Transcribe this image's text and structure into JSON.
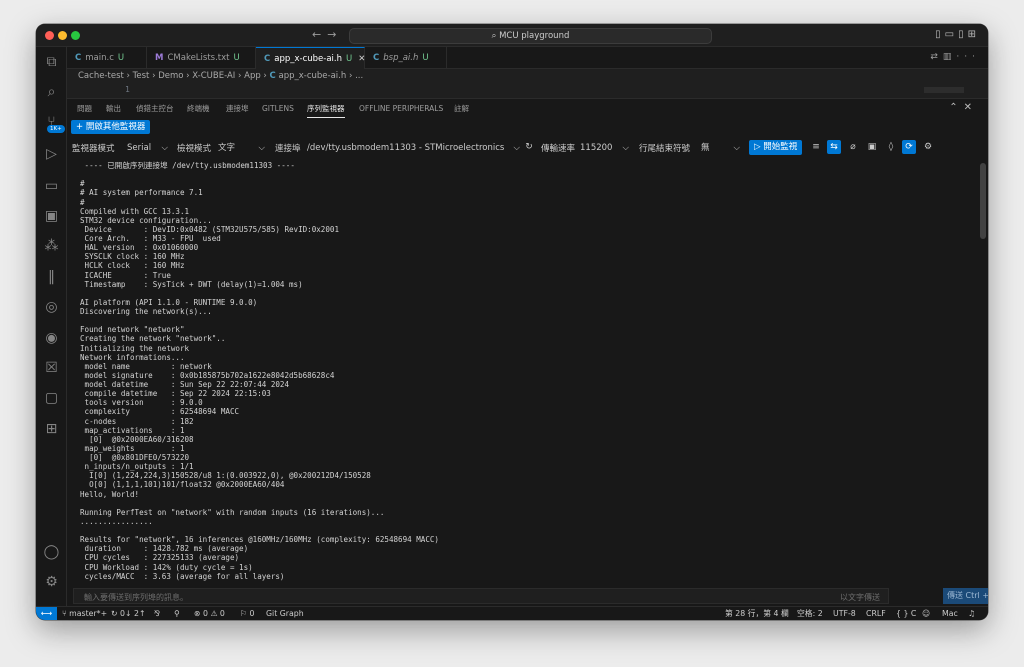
{
  "window": {
    "title": "MCU playground",
    "search_icon": "search-icon"
  },
  "tabs": [
    {
      "lang": "C",
      "label": "main.c",
      "status": "U",
      "active": false
    },
    {
      "lang": "M",
      "label": "CMakeLists.txt",
      "status": "U",
      "active": false
    },
    {
      "lang": "C",
      "label": "app_x-cube-ai.h",
      "status": "U",
      "active": true
    },
    {
      "lang": "C",
      "label": "bsp_ai.h",
      "status": "U",
      "active": false
    }
  ],
  "breadcrumb": {
    "parts": [
      "Cache-test",
      "Test",
      "Demo",
      "X-CUBE-AI",
      "App",
      "C",
      "app_x-cube-ai.h",
      "..."
    ]
  },
  "editor": {
    "line_number": "1"
  },
  "panel": {
    "tabs": [
      "問題",
      "輸出",
      "偵錯主控台",
      "終端機",
      "連接埠",
      "GITLENS",
      "序列監視器",
      "OFFLINE PERIPHERALS",
      "註解"
    ],
    "active_tab": "序列監視器",
    "open_other_monitor": "開啟其他監視器"
  },
  "monitor": {
    "mode_label": "監視器模式",
    "mode_value": "Serial",
    "view_label": "檢視模式",
    "view_value": "文字",
    "port_label": "連接埠",
    "port_value": "/dev/tty.usbmodem11303 - STMicroelectronics",
    "baud_label": "傳輸速率",
    "baud_value": "115200",
    "eol_label": "行尾結束符號",
    "eol_value": "無",
    "start_button": "開始監視"
  },
  "output_lines": [
    " ---- 已開啟序列連接埠 /dev/tty.usbmodem11303 ----",
    "",
    "#",
    "# AI system performance 7.1",
    "#",
    "Compiled with GCC 13.3.1",
    "STM32 device configuration...",
    " Device       : DevID:0x0482 (STM32U575/585) RevID:0x2001",
    " Core Arch.   : M33 - FPU  used",
    " HAL version  : 0x01060000",
    " SYSCLK clock : 160 MHz",
    " HCLK clock   : 160 MHz",
    " ICACHE       : True",
    " Timestamp    : SysTick + DWT (delay(1)=1.004 ms)",
    "",
    "AI platform (API 1.1.0 - RUNTIME 9.0.0)",
    "Discovering the network(s)...",
    "",
    "Found network \"network\"",
    "Creating the network \"network\"..",
    "Initializing the network",
    "Network informations...",
    " model name         : network",
    " model signature    : 0x0b185875b702a1622e8042d5b68628c4",
    " model datetime     : Sun Sep 22 22:07:44 2024",
    " compile datetime   : Sep 22 2024 22:15:03",
    " tools version      : 9.0.0",
    " complexity         : 62548694 MACC",
    " c-nodes            : 182",
    " map_activations    : 1",
    "  [0]  @0x2000EA60/316208",
    " map_weights        : 1",
    "  [0]  @0x801DFE0/573220",
    " n_inputs/n_outputs : 1/1",
    "  I[0] (1,224,224,3)150528/u8 1:(0.003922,0), @0x200212D4/150528",
    "  O[0] (1,1,1,101)101/float32 @0x2000EA60/404",
    "Hello, World!",
    "",
    "Running PerfTest on \"network\" with random inputs (16 iterations)...",
    "................",
    "",
    "Results for \"network\", 16 inferences @160MHz/160MHz (complexity: 62548694 MACC)",
    " duration     : 1428.782 ms (average)",
    " CPU cycles   : 227325133 (average)",
    " CPU Workload : 142% (duty cycle = 1s)",
    " cycles/MACC  : 3.63 (average for all layers)"
  ],
  "input_bar": {
    "placeholder": "輸入要傳送到序列埠的訊息。",
    "hint": "以文字傳送",
    "send_button": "傳送 Ctrl + C"
  },
  "status_bar": {
    "branch": "master*+",
    "sync": "0↓ 2↑",
    "problems": "⊗ 0 ⚠ 0",
    "ports": "0",
    "git_graph": "Git Graph",
    "cursor": "第 28 行，第 4 欄",
    "spaces": "空格: 2",
    "encoding": "UTF-8",
    "eol": "CRLF",
    "language": "{ } C",
    "platform": "Mac"
  },
  "colors": {
    "accent": "#0078d4",
    "background": "#181818",
    "modified": "#73c991"
  }
}
